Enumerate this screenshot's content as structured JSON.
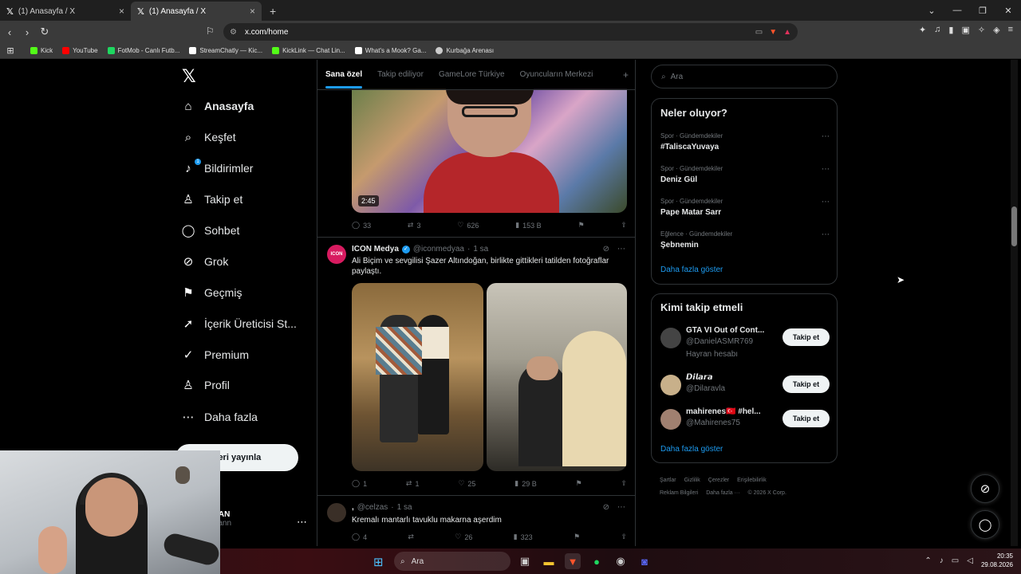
{
  "browser": {
    "tabs": [
      {
        "title": "(1) Anasayfa / X"
      },
      {
        "title": "(1) Anasayfa / X"
      }
    ],
    "url": "x.com/home",
    "bookmarks": [
      {
        "label": "Kick",
        "color": "#53fc18"
      },
      {
        "label": "YouTube",
        "color": "#ff0000"
      },
      {
        "label": "FotMob - Canlı Futb...",
        "color": "#1ed760"
      },
      {
        "label": "StreamChatly — Kic...",
        "color": "#ffffff"
      },
      {
        "label": "KickLink — Chat Lin...",
        "color": "#53fc18"
      },
      {
        "label": "What's a Mook? Ga...",
        "color": "#ffffff"
      },
      {
        "label": "Kurbağa Arenası",
        "color": "#cccccc"
      }
    ]
  },
  "nav": {
    "items": [
      {
        "label": "Anasayfa",
        "icon": "home-icon",
        "glyph": "⌂"
      },
      {
        "label": "Keşfet",
        "icon": "search-icon",
        "glyph": "⌕"
      },
      {
        "label": "Bildirimler",
        "icon": "bell-icon",
        "glyph": "♪",
        "badge": "1"
      },
      {
        "label": "Takip et",
        "icon": "follow-icon",
        "glyph": "♙"
      },
      {
        "label": "Sohbet",
        "icon": "chat-icon",
        "glyph": "◯"
      },
      {
        "label": "Grok",
        "icon": "grok-icon",
        "glyph": "⊘"
      },
      {
        "label": "Geçmiş",
        "icon": "bookmark-icon",
        "glyph": "⚑"
      },
      {
        "label": "İçerik Üreticisi St...",
        "icon": "rocket-icon",
        "glyph": "➚"
      },
      {
        "label": "Premium",
        "icon": "verified-icon",
        "glyph": "✓"
      },
      {
        "label": "Profil",
        "icon": "profile-icon",
        "glyph": "♙"
      },
      {
        "label": "Daha fazla",
        "icon": "more-icon",
        "glyph": "⋯"
      }
    ],
    "post_button": "deri yayınla",
    "account_name": "LGAN",
    "account_handle": "algann"
  },
  "timeline": {
    "tabs": [
      "Sana özel",
      "Takip ediliyor",
      "GameLore Türkiye",
      "Oyuncuların Merkezi"
    ],
    "video_time": "2:45",
    "tweet0_actions": {
      "replies": "33",
      "retweets": "3",
      "likes": "626",
      "views": "153 B"
    },
    "tweet1": {
      "name": "ICON Medya",
      "handle": "@iconmedyaa",
      "time": "1 sa",
      "avatar_text": "ICON",
      "text": "Ali Biçim ve sevgilisi Şazer Altındoğan, birlikte gittikleri tatilden fotoğraflar paylaştı.",
      "replies": "1",
      "retweets": "1",
      "likes": "25",
      "views": "29 B"
    },
    "tweet2": {
      "name": ",",
      "handle": "@celzas",
      "time": "1 sa",
      "text": "Kremalı mantarlı tavuklu makarna aşerdim",
      "replies": "4",
      "likes": "26",
      "views": "323"
    }
  },
  "sidebar": {
    "search_placeholder": "Ara",
    "trends_title": "Neler oluyor?",
    "trends": [
      {
        "category": "Spor · Gündemdekiler",
        "title": "#TaliscaYuvaya"
      },
      {
        "category": "Spor · Gündemdekiler",
        "title": "Deniz Gül"
      },
      {
        "category": "Spor · Gündemdekiler",
        "title": "Pape Matar Sarr"
      },
      {
        "category": "Eğlence · Gündemdekiler",
        "title": "Şebnemin"
      }
    ],
    "show_more": "Daha fazla göster",
    "who_title": "Kimi takip etmeli",
    "who": [
      {
        "name": "GTA VI Out of Cont...",
        "handle": "@DanielASMR769",
        "sub": "Hayran hesabı",
        "color": "#444444"
      },
      {
        "name": "𝘿𝙞𝙡𝙖𝙧𝙖",
        "handle": "@Dilaravla",
        "sub": "",
        "color": "#c8b08a"
      },
      {
        "name": "mahirenes🇹🇷 #hel...",
        "handle": "@Mahirenes75",
        "sub": "",
        "color": "#a08070"
      }
    ],
    "follow_label": "Takip et",
    "footer": [
      "Şartlar",
      "Gizlilik",
      "Çerezler",
      "Erişilebilirlik",
      "Reklam Bilgileri",
      "Daha fazla ···",
      "© 2026 X Corp."
    ]
  },
  "taskbar": {
    "search": "Ara",
    "time": "20:35",
    "date": "29.08.2026"
  }
}
